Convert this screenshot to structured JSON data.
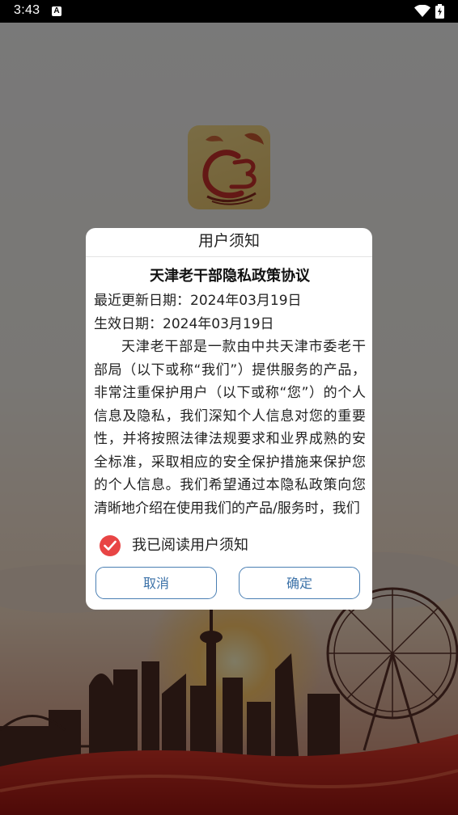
{
  "status_bar": {
    "time": "3:43",
    "notification_icon": "a-letter-icon",
    "wifi_icon": "wifi-icon",
    "battery_icon": "battery-charging-icon"
  },
  "app_logo": {
    "icon": "app-logo-icon"
  },
  "dialog": {
    "title": "用户须知",
    "policy_title": "天津老干部隐私政策协议",
    "updated_date": "最近更新日期：2024年03月19日",
    "effective_date": "生效日期：2024年03月19日",
    "body": "天津老干部是一款由中共天津市委老干部局（以下或称“我们”）提供服务的产品，非常注重保护用户（以下或称“您”）的个人信息及隐私，我们深知个人信息对您的重要性，并将按照法律法规要求和业界成熟的安全标准，采取相应的安全保护措施来保护您的个人信息。我们希望通过本隐私政策向您清晰地介绍在使用我们的产品/服务时，我们",
    "agree_label": "我已阅读用户须知",
    "agree_checked": true,
    "cancel_label": "取消",
    "confirm_label": "确定"
  },
  "colors": {
    "check_red": "#e84545",
    "button_border": "#4a7fb3",
    "button_text": "#3c72a8"
  }
}
